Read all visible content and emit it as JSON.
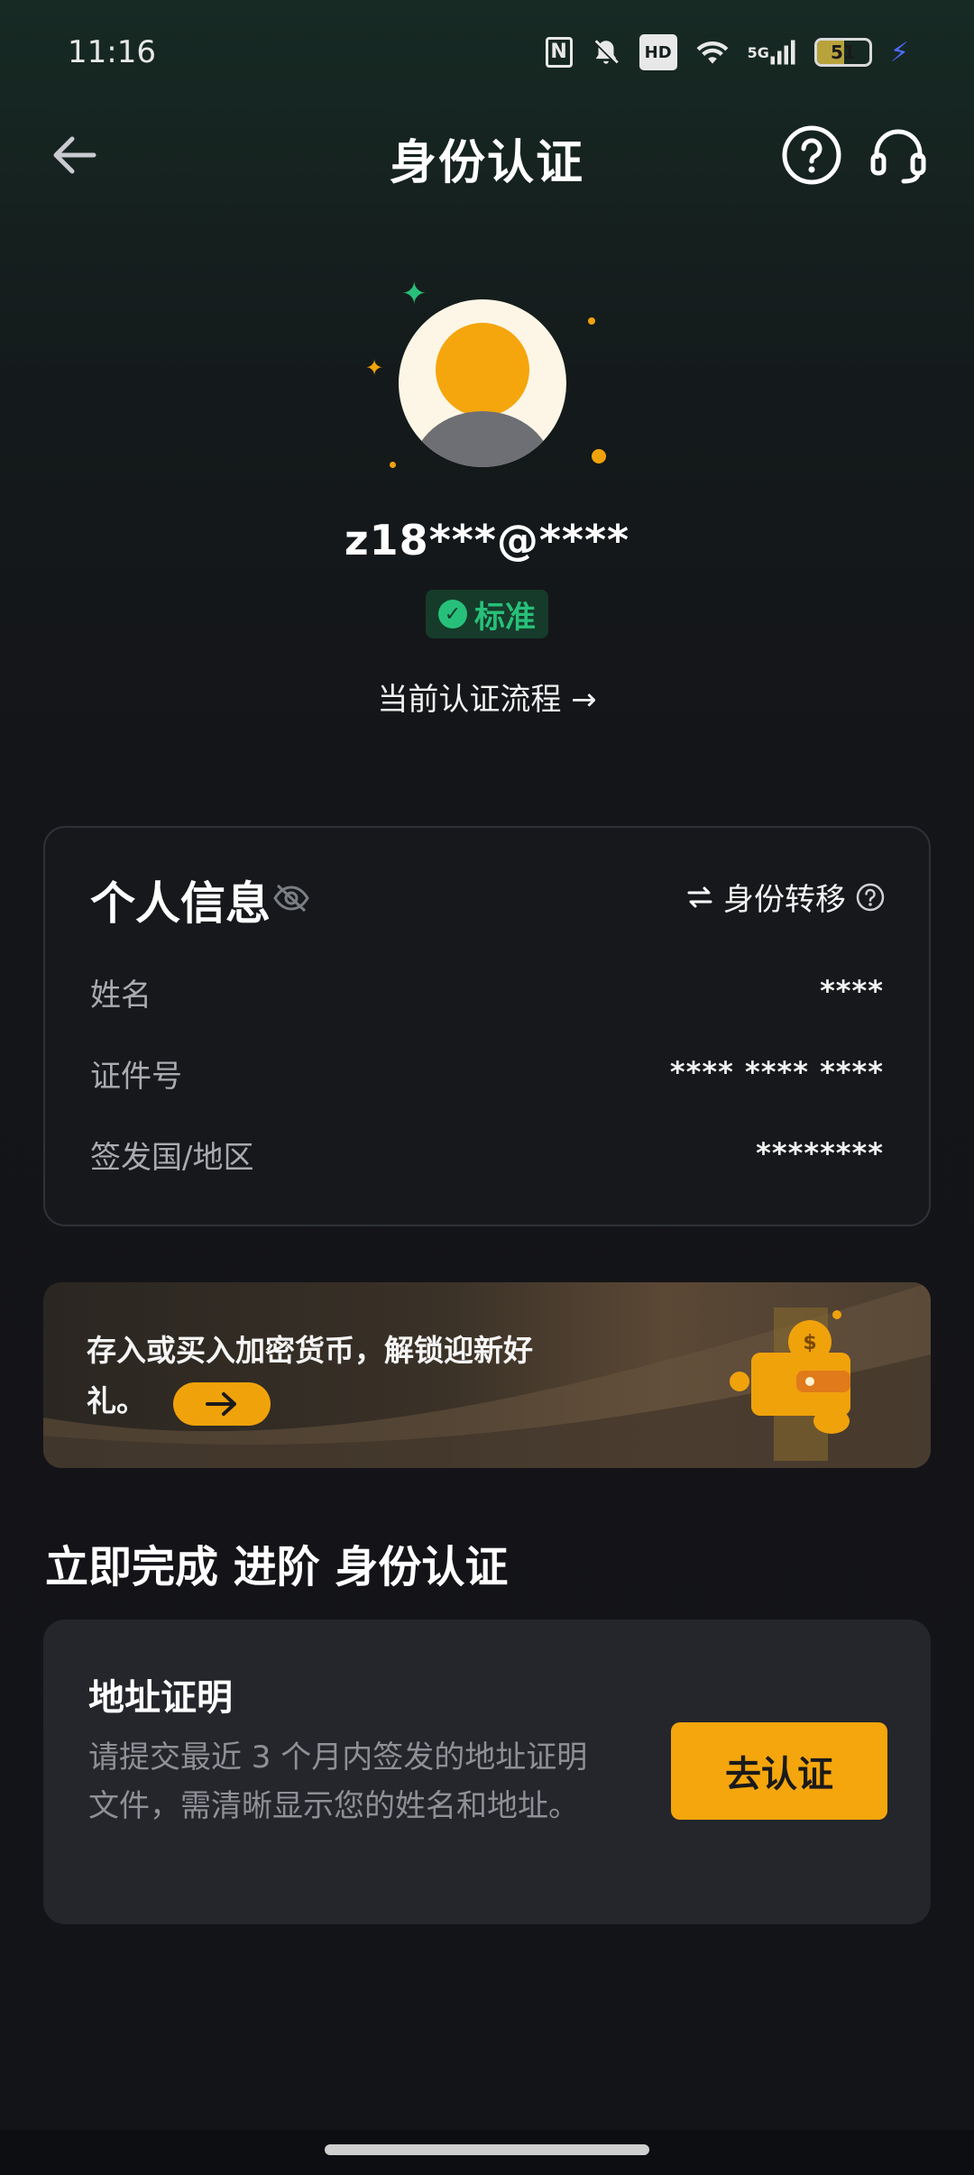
{
  "status_bar": {
    "time": "11:16",
    "network": "5G",
    "battery": "51"
  },
  "header": {
    "title": "身份认证",
    "back_icon": "arrow-left-icon",
    "help_icon": "question-circle-icon",
    "support_icon": "headset-icon"
  },
  "profile": {
    "account": "z18***@****",
    "level_badge": "标准",
    "flow_link": "当前认证流程"
  },
  "personal_info": {
    "title": "个人信息",
    "transfer_label": "身份转移",
    "rows": [
      {
        "label": "姓名",
        "value": "****"
      },
      {
        "label": "证件号",
        "value": "**** **** ****"
      },
      {
        "label": "签发国/地区",
        "value": "********"
      }
    ]
  },
  "promo_banner": {
    "text": "存入或买入加密货币，解锁迎新好礼。"
  },
  "advanced": {
    "section_title": "立即完成 进阶 身份认证",
    "card_title": "地址证明",
    "card_desc": "请提交最近 3 个月内签发的地址证明文件，需清晰显示您的姓名和地址。",
    "button": "去认证"
  },
  "colors": {
    "accent": "#F5A60D",
    "success": "#27C07A",
    "card_bg": "#24262B"
  }
}
